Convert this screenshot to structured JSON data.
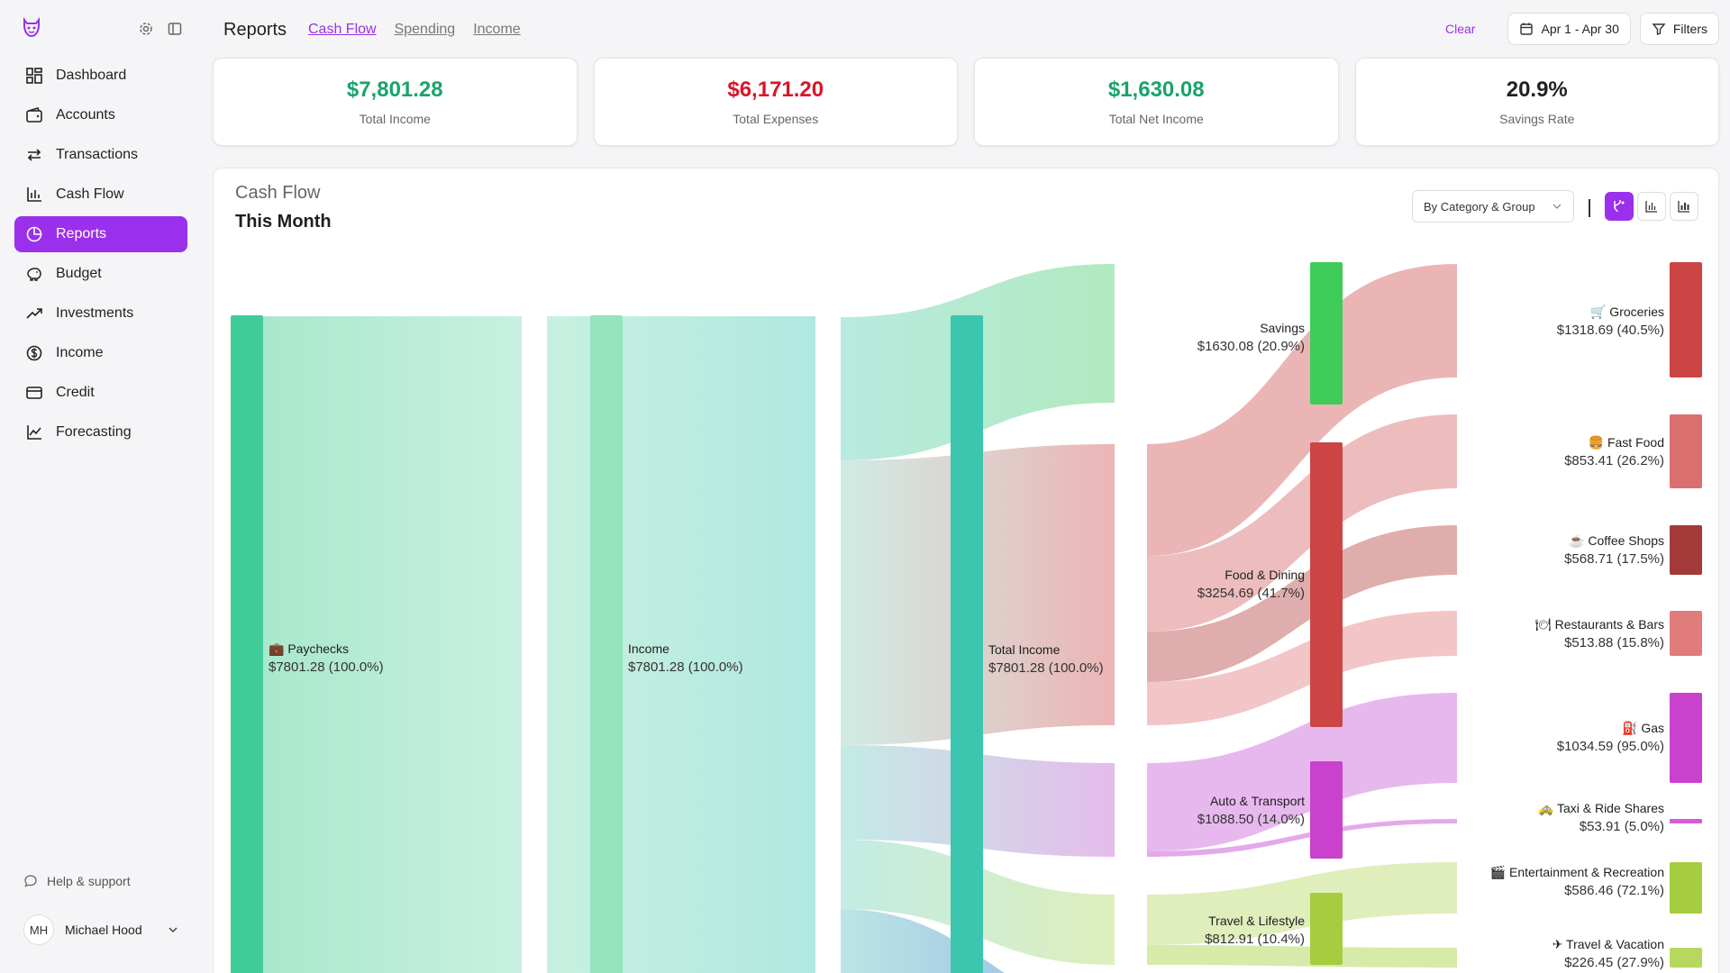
{
  "sidebar": {
    "items": [
      {
        "label": "Dashboard",
        "icon": "dashboard-icon"
      },
      {
        "label": "Accounts",
        "icon": "wallet-icon"
      },
      {
        "label": "Transactions",
        "icon": "arrows-icon"
      },
      {
        "label": "Cash Flow",
        "icon": "bar-chart-icon"
      },
      {
        "label": "Reports",
        "icon": "pie-chart-icon",
        "active": true
      },
      {
        "label": "Budget",
        "icon": "piggy-bank-icon"
      },
      {
        "label": "Investments",
        "icon": "trending-up-icon"
      },
      {
        "label": "Income",
        "icon": "dollar-icon"
      },
      {
        "label": "Credit",
        "icon": "credit-card-icon"
      },
      {
        "label": "Forecasting",
        "icon": "line-chart-icon"
      }
    ],
    "help_label": "Help & support",
    "user": {
      "initials": "MH",
      "name": "Michael Hood"
    }
  },
  "header": {
    "title": "Reports",
    "tabs": [
      "Cash Flow",
      "Spending",
      "Income"
    ],
    "clear_label": "Clear",
    "date_range": "Apr 1 - Apr 30",
    "filters_label": "Filters"
  },
  "summary": [
    {
      "value": "$7,801.28",
      "label": "Total Income",
      "color": "#1aa36a"
    },
    {
      "value": "$6,171.20",
      "label": "Total Expenses",
      "color": "#d8152a"
    },
    {
      "value": "$1,630.08",
      "label": "Total Net Income",
      "color": "#1aa36a"
    },
    {
      "value": "20.9%",
      "label": "Savings Rate",
      "color": "#222222"
    }
  ],
  "panel": {
    "title": "Cash Flow",
    "subtitle": "This Month",
    "group_by": "By Category & Group"
  },
  "sankey": {
    "nodes": {
      "paychecks": {
        "label": "💼 Paychecks",
        "value": "$7801.28 (100.0%)",
        "color": "#3fcc99"
      },
      "income": {
        "label": "Income",
        "value": "$7801.28 (100.0%)",
        "color": "#95e3bf"
      },
      "total_income": {
        "label": "Total Income",
        "value": "$7801.28 (100.0%)",
        "color": "#3cc6b0"
      },
      "savings": {
        "label": "Savings",
        "value": "$1630.08 (20.9%)",
        "color": "#3fcc58"
      },
      "food": {
        "label": "Food & Dining",
        "value": "$3254.69 (41.7%)",
        "color": "#cc4444"
      },
      "auto": {
        "label": "Auto & Transport",
        "value": "$1088.50 (14.0%)",
        "color": "#c941cc"
      },
      "travel": {
        "label": "Travel & Lifestyle",
        "value": "$812.91 (10.4%)",
        "color": "#a6cc3f"
      },
      "groceries": {
        "label": "🛒 Groceries",
        "value": "$1318.69 (40.5%)",
        "color": "#cc4444"
      },
      "fastfood": {
        "label": "🍔 Fast Food",
        "value": "$853.41 (26.2%)",
        "color": "#db6f6f"
      },
      "coffee": {
        "label": "☕ Coffee Shops",
        "value": "$568.71 (17.5%)",
        "color": "#a33a3a"
      },
      "restaurants": {
        "label": "🍽 Restaurants & Bars",
        "value": "$513.88 (15.8%)",
        "color": "#e07c7c"
      },
      "gas": {
        "label": "⛽ Gas",
        "value": "$1034.59 (95.0%)",
        "color": "#c941cc"
      },
      "taxi": {
        "label": "🚕 Taxi & Ride Shares",
        "value": "$53.91 (5.0%)",
        "color": "#d35cd6"
      },
      "entertainment": {
        "label": "🎬 Entertainment & Recreation",
        "value": "$586.46 (72.1%)",
        "color": "#a6cc3f"
      },
      "vacation": {
        "label": "✈ Travel & Vacation",
        "value": "$226.45 (27.9%)",
        "color": "#b7d75f"
      }
    }
  }
}
